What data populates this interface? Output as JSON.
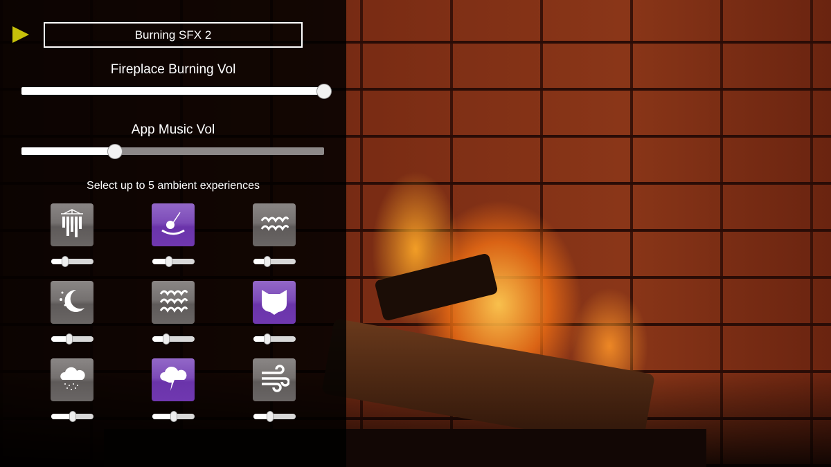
{
  "header": {
    "play_icon": "play-triangle-icon",
    "play_color": "#c7c10a",
    "selected_sound": "Burning SFX 2"
  },
  "fireplace_volume": {
    "label": "Fireplace Burning Vol",
    "value": 1.0
  },
  "music_volume": {
    "label": "App Music Vol",
    "value": 0.31
  },
  "ambient": {
    "hint": "Select up to 5 ambient experiences",
    "active_color": "#7c4bb8",
    "inactive_color": "#757170",
    "items": [
      {
        "icon": "wind-chimes-icon",
        "active": false,
        "volume": 0.32
      },
      {
        "icon": "pendulum-icon",
        "active": true,
        "volume": 0.39
      },
      {
        "icon": "waves-icon",
        "active": false,
        "volume": 0.32
      },
      {
        "icon": "night-moon-icon",
        "active": false,
        "volume": 0.42
      },
      {
        "icon": "ocean-waves-icon",
        "active": false,
        "volume": 0.33
      },
      {
        "icon": "cat-icon",
        "active": true,
        "volume": 0.32
      },
      {
        "icon": "rain-cloud-icon",
        "active": false,
        "volume": 0.5
      },
      {
        "icon": "thunderstorm-icon",
        "active": true,
        "volume": 0.5
      },
      {
        "icon": "wind-icon",
        "active": false,
        "volume": 0.4
      }
    ]
  }
}
